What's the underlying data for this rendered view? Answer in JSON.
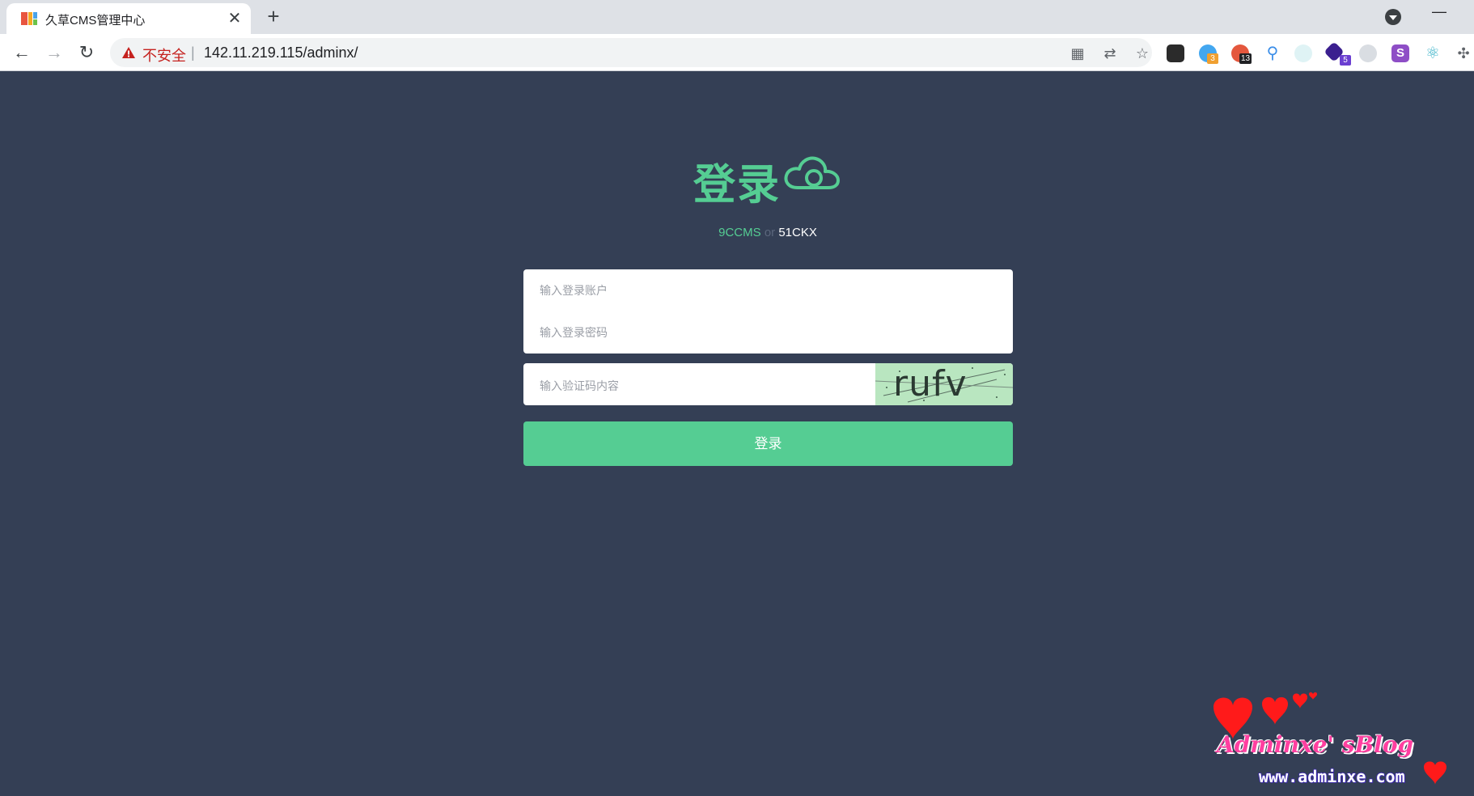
{
  "browser": {
    "tab_title": "久草CMS管理中心",
    "close_glyph": "✕",
    "new_tab_glyph": "+",
    "security_label": "不安全",
    "url": "142.11.219.115/adminx/",
    "extension_badges": [
      "3",
      "13",
      "5"
    ]
  },
  "login": {
    "heading": "登录",
    "subtitle_brand_a": "9CCMS",
    "subtitle_or": "or",
    "subtitle_brand_b": "51CKX",
    "username_placeholder": "输入登录账户",
    "password_placeholder": "输入登录密码",
    "captcha_placeholder": "输入验证码内容",
    "captcha_text": "rufv",
    "submit_label": "登录"
  },
  "watermark": {
    "blog": "Adminxe' sBlog",
    "url": "www.adminxe.com"
  },
  "colors": {
    "page_background": "#343f55",
    "accent": "#55cd93",
    "insecure_red": "#c5221f"
  }
}
